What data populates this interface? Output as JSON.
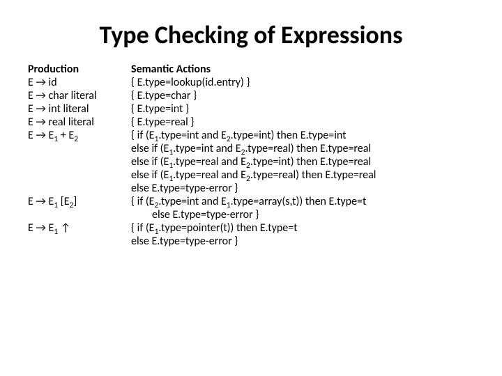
{
  "title": "Type Checking of Expressions",
  "headers": {
    "production": "Production",
    "actions": "Semantic Actions"
  },
  "rows": {
    "r1": {
      "prod_pre": " E → id",
      "act": "{ E.type=lookup(id.entry) }"
    },
    "r2": {
      "prod": "E → char literal",
      "act": "{ E.type=char }"
    },
    "r3": {
      "prod": "E → int literal",
      "act": "{ E.type=int }"
    },
    "r4": {
      "prod": "E → real literal",
      "act": "{ E.type=real }"
    },
    "r5": {
      "prod_a": "E → E",
      "prod_s1": "1",
      "prod_b": " + E",
      "prod_s2": "2",
      "l1a": "{ if (E",
      "l1b": ".type=int and E",
      "l1c": ".type=int) then E.type=int",
      "l2a": "else if (E",
      "l2b": ".type=int and E",
      "l2c": ".type=real) then E.type=real",
      "l3a": "else if (E",
      "l3b": ".type=real and E",
      "l3c": ".type=int) then E.type=real",
      "l4a": "else if (E",
      "l4b": ".type=real and E",
      "l4c": ".type=real) then E.type=real",
      "l5": "else E.type=type-error  }"
    },
    "r6": {
      "prod_a": "E → E",
      "prod_s1": "1",
      "prod_b": " [E",
      "prod_s2": "2",
      "prod_c": "]",
      "l1a": "{ if (E",
      "l1b": ".type=int and E",
      "l1c": ".type=array(s,t)) then E.type=t",
      "l2": "else E.type=type-error }"
    },
    "r7": {
      "prod_a": "E → E",
      "prod_s1": "1",
      "prod_b": " ↑",
      "l1a": "{ if (E",
      "l1b": ".type=pointer(t)) then   E.type=t",
      "l2": " else E.type=type-error }"
    }
  }
}
